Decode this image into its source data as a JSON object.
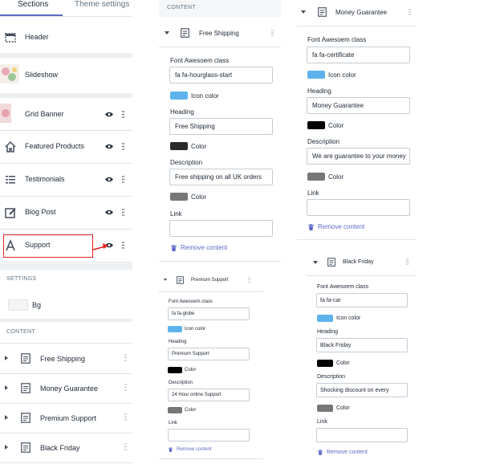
{
  "tabs": {
    "sections": "Sections",
    "theme_settings": "Theme settings"
  },
  "sidebar": {
    "sections": [
      {
        "label": "Header",
        "icon": "header-icon"
      },
      {
        "label": "Slideshow",
        "icon": "slideshow-thumbnail"
      },
      {
        "label": "Grid Banner",
        "icon": "grid-banner-thumbnail"
      },
      {
        "label": "Featured Products",
        "icon": "home-icon"
      },
      {
        "label": "Testimonials",
        "icon": "list-icon"
      },
      {
        "label": "Blog Post",
        "icon": "edit-icon"
      },
      {
        "label": "Support",
        "icon": "font-icon"
      }
    ],
    "settings_caption": "SETTINGS",
    "bg_label": "Bg",
    "content_caption": "CONTENT",
    "content_items": [
      "Free Shipping",
      "Money Guarantee",
      "Premium Support",
      "Black Friday"
    ]
  },
  "panel_free_shipping": {
    "caption": "CONTENT",
    "title": "Free Shipping",
    "fa_label": "Font Awesoem class",
    "fa_value": "fa fa-hourglass-start",
    "icon_color_label": "Icon color",
    "icon_color": "#5eb3ec",
    "heading_label": "Heading",
    "heading_value": "Free Shipping",
    "color_label": "Color",
    "color": "#2a2a2a",
    "description_label": "Description",
    "description_value": "Free shipping on all UK orders",
    "color2_label": "Color",
    "color2": "#777777",
    "link_label": "Link",
    "link_value": "",
    "remove_label": "Remove content"
  },
  "panel_premium_support": {
    "title": "Premium Support",
    "fa_label": "Font Awesoem class",
    "fa_value": "fa fa-globe",
    "icon_color_label": "Icon color",
    "icon_color": "#5eb3ec",
    "heading_label": "Heading",
    "heading_value": "Premium Support",
    "color_label": "Color",
    "color": "#000000",
    "description_label": "Description",
    "description_value": "24 Hour online Support",
    "color2_label": "Color",
    "color2": "#777777",
    "link_label": "Link",
    "link_value": "",
    "remove_label": "Remove content"
  },
  "panel_money_guarantee": {
    "title": "Money Guarantee",
    "fa_label": "Font Awesoem class",
    "fa_value": "fa fa-certificate",
    "icon_color_label": "Icon color",
    "icon_color": "#5eb3ec",
    "heading_label": "Heading",
    "heading_value": "Money Guarantee",
    "color_label": "Color",
    "color": "#000000",
    "description_label": "Description",
    "description_value": "We are guarantee to your money",
    "color2_label": "Color",
    "color2": "#777777",
    "link_label": "Link",
    "link_value": "",
    "remove_label": "Remove content"
  },
  "panel_black_friday": {
    "title": "Black Friday",
    "fa_label": "Font Awesoem class",
    "fa_value": "fa fa-car",
    "icon_color_label": "Icon color",
    "icon_color": "#5eb3ec",
    "heading_label": "Heading",
    "heading_value": "Black Friday",
    "color_label": "Color",
    "color": "#000000",
    "description_label": "Description",
    "description_value": "Shocking discount on every",
    "color2_label": "Color",
    "color2": "#777777",
    "link_label": "Link",
    "link_value": "",
    "remove_label": "Remove content"
  },
  "colors": {
    "accent": "#5c6ac4",
    "highlight": "#e02020"
  }
}
